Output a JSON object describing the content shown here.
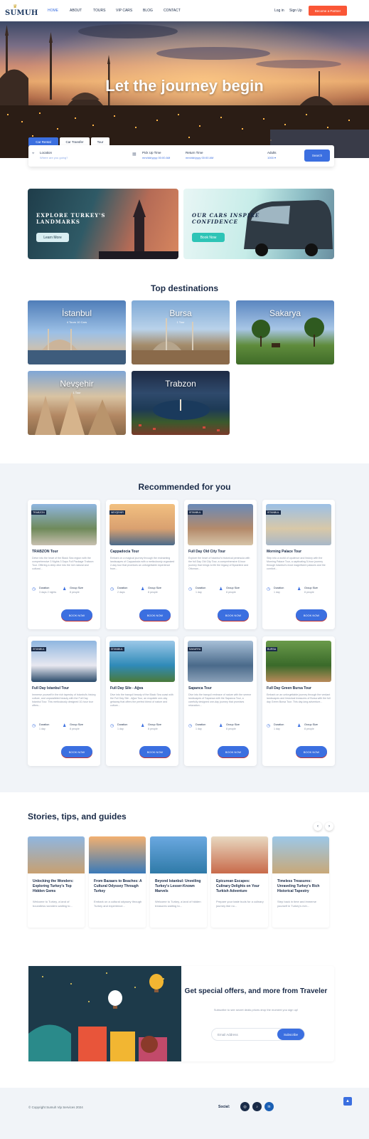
{
  "brand": {
    "logo_text": "SUMUH"
  },
  "nav": {
    "items": [
      "HOME",
      "ABOUT",
      "TOURS",
      "VIP CARS",
      "BLOG",
      "CONTACT"
    ],
    "login": "Log in",
    "signup": "Sign Up",
    "partner": "Become a Partner"
  },
  "hero": {
    "title": "Let the journey begin"
  },
  "search": {
    "tabs": [
      "Car Rental",
      "Car Transfer",
      "Tour"
    ],
    "location_label": "Location",
    "location_placeholder": "Where are you going?",
    "pickup_label": "Pick Up Time",
    "pickup_value": "mm/dd/yyyy 00:00 AM",
    "return_label": "Return Time",
    "return_value": "mm/dd/yyyy 00:00 AM",
    "adult_label": "Adults",
    "adult_value": "1000 ▾",
    "button": "Search"
  },
  "promos": [
    {
      "title_line1": "EXPLORE TURKEY'S",
      "title_line2": "LANDMARKS",
      "button": "Learn More"
    },
    {
      "title_line1": "OUR CARS INSPIRE",
      "title_line2": "CONFIDENCE",
      "button": "Book Now"
    }
  ],
  "destinations": {
    "title": "Top destinations",
    "items": [
      {
        "name": "İstanbul",
        "info": "4 Tours   10 Cars"
      },
      {
        "name": "Bursa",
        "info": "1 Tour"
      },
      {
        "name": "Sakarya",
        "info": ""
      },
      {
        "name": "Nevşehir",
        "info": "1 Tour"
      },
      {
        "name": "Trabzon",
        "info": ""
      }
    ]
  },
  "recommended": {
    "title": "Recommended for you",
    "duration_label": "Duration",
    "group_label": "Group Size",
    "book_label": "BOOK NOW",
    "cards": [
      {
        "badge": "TRABZON",
        "title": "TRABZON Tour",
        "desc": "Delve into the heart of the Black Sea region with the comprehensive 3 Nights 3 Days Full Package Trabzon Tour. Offering a deep dive into the rich natural and cultural...",
        "duration": "3 days 2 nights",
        "group": "8 people"
      },
      {
        "badge": "NEVŞEHİR",
        "title": "Cappadocia Tour",
        "desc": "Embark on a magical journey through the enchanting landscapes of Cappadocia with a meticulously organized 2-day tour that promises an unforgettable experience from...",
        "duration": "2 days",
        "group": "8 people"
      },
      {
        "badge": "İSTANBUL",
        "title": "Full Day Old City Tour",
        "desc": "Explore the heart of Istanbul's historical peninsula with the full Day Old City Tour, a comprehensive 8-hour journey that brings to life the legacy of Byzantine and Ottoman...",
        "duration": "1 day",
        "group": "8 people"
      },
      {
        "badge": "İSTANBUL",
        "title": "Morning Palace Tour",
        "desc": "Step into a world of opulence and history with the Morning Palace Tour, a captivating 5-hour journey through Istanbul's most magnificent palaces and the comfort...",
        "duration": "1 day",
        "group": "8 people"
      },
      {
        "badge": "İSTANBUL",
        "title": "Full Day Istanbul Tour",
        "desc": "Immerse yourself in the rich tapestry of Istanbul's history, culture, and unparalleled beauty with the Full Day Istanbul Tour. This meticulously designed 10-hour tour offers...",
        "duration": "1 day",
        "group": "8 people"
      },
      {
        "badge": "İSTANBUL",
        "title": "Full Day Sile - Ağva",
        "desc": "Dive into the tranquil beauty of the Black Sea coast with the Full Day Sile - Ağva Tour, an exquisite one-day getaway that offers the perfect blend of nature and culture...",
        "duration": "1 day",
        "group": "8 people"
      },
      {
        "badge": "SAKARYA",
        "title": "Sapanca Tour",
        "desc": "Dive into the tranquil embrace of nature with the serene landscapes of Sapanca with the Sapanca Tour, a carefully designed one-day journey that promises relaxation...",
        "duration": "1 day",
        "group": "8 people"
      },
      {
        "badge": "BURSA",
        "title": "Full Day Green Bursa Tour",
        "desc": "Embark on an unforgettable journey through the verdant landscapes and historical treasures of Bursa with the full day Green Bursa Tour. This day-long adventure...",
        "duration": "1 day",
        "group": "8 people"
      }
    ]
  },
  "stories": {
    "title": "Stories, tips, and guides",
    "prev": "‹",
    "next": "›",
    "items": [
      {
        "title": "Unlocking the Wonders: Exploring Turkey's Top Hidden Gems",
        "desc": "Welcome to Turkey, a land of boundless wonders waiting to..."
      },
      {
        "title": "From Bazaars to Beaches: A Cultural Odyssey Through Turkey",
        "desc": "Embark on a cultural odyssey through Turkey and experience..."
      },
      {
        "title": "Beyond Istanbul: Unveiling Turkey's Lesser-Known Marvels",
        "desc": "Welcome to Turkey, a land of hidden treasures waiting to..."
      },
      {
        "title": "Epicurean Escapes: Culinary Delights on Your Turkish Adventure",
        "desc": "Prepare your taste buds for a culinary journey like no..."
      },
      {
        "title": "Timeless Treasures: Unraveling Turkey's Rich Historical Tapestry",
        "desc": "Step back in time and immerse yourself in Turkey's rich..."
      }
    ]
  },
  "subscribe": {
    "title": "Get special offers, and more from Traveler",
    "desc": "Subscribe to see secret deals prices drop the moment you sign up!",
    "placeholder": "Email Address",
    "button": "Subscribe"
  },
  "footer": {
    "copyright": "© Copyright Sumuh Vip Services 2024",
    "social_label": "Social:",
    "social": [
      "instagram-icon",
      "tiktok-icon",
      "linkedin-icon"
    ]
  },
  "colors": {
    "accent": "#3b6fe0",
    "partner": "#fa5636",
    "navy": "#1a2b48"
  }
}
